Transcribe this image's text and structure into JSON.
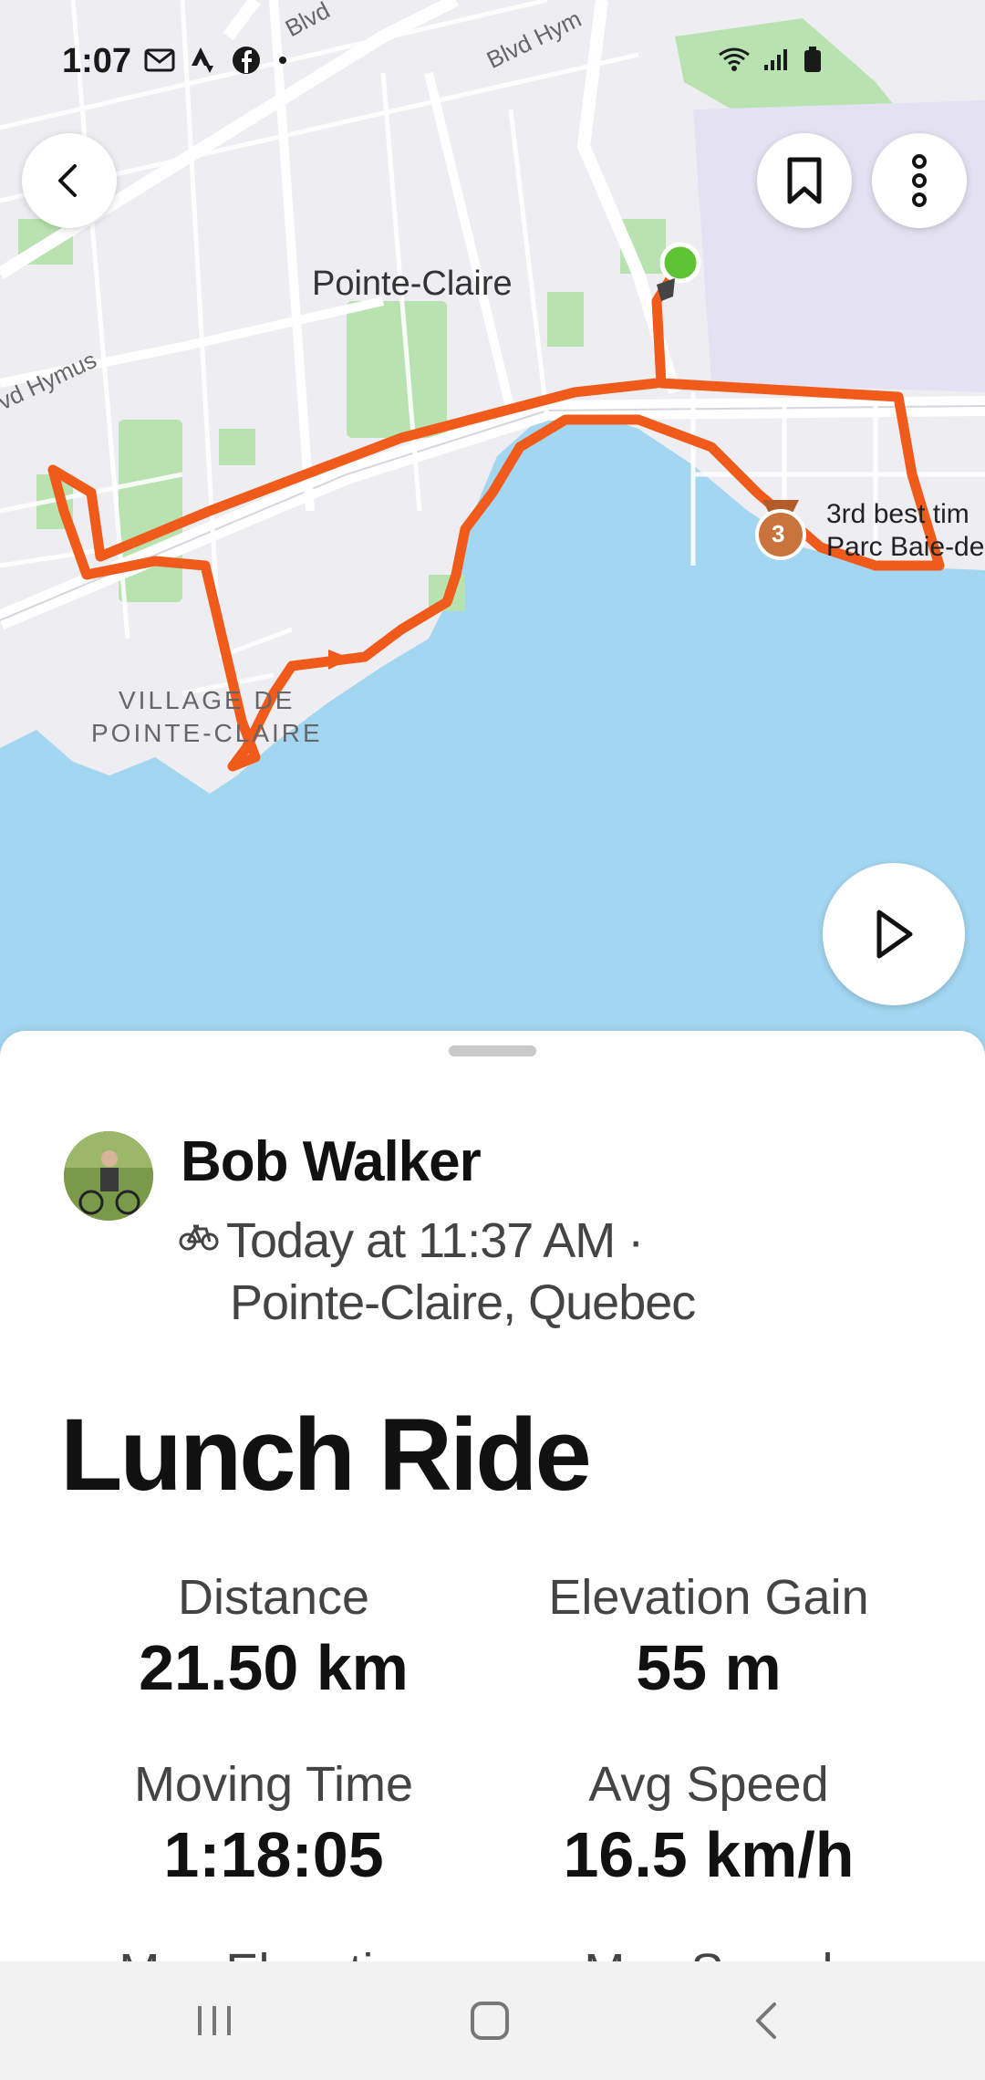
{
  "status_bar": {
    "time": "1:07",
    "icons_left": [
      "mail-icon",
      "strava-icon",
      "facebook-icon",
      "dot-icon"
    ],
    "icons_right": [
      "wifi-icon",
      "signal-icon",
      "battery-icon"
    ]
  },
  "map": {
    "labels": {
      "city": "Pointe-Claire",
      "village_line1": "VILLAGE DE",
      "village_line2": "POINTE-CLAIRE",
      "road_1": "Blvd",
      "road_2": "Blvd Hym",
      "road_3": "vd Hymus"
    },
    "segment": {
      "rank_badge": "3",
      "label_line1": "3rd best tim",
      "label_line2": "Parc Baie-de"
    },
    "colors": {
      "water": "#a3d6f1",
      "land": "#eeeef2",
      "park": "#b8e3b0",
      "route": "#f05a1a",
      "start": "#5ec435"
    }
  },
  "activity": {
    "athlete": "Bob Walker",
    "date_line": "Today at 11:37 AM ·",
    "location": "Pointe-Claire, Quebec",
    "sport_icon": "bike-icon",
    "title": "Lunch Ride"
  },
  "stats": [
    {
      "label": "Distance",
      "value": "21.50 km"
    },
    {
      "label": "Elevation Gain",
      "value": "55 m"
    },
    {
      "label": "Moving Time",
      "value": "1:18:05"
    },
    {
      "label": "Avg Speed",
      "value": "16.5 km/h"
    },
    {
      "label": "Max Elevation",
      "value": ""
    },
    {
      "label": "Max Speed",
      "value": ""
    }
  ],
  "partial_labels": {
    "left": "Max Elevation",
    "right": "Max Speed"
  }
}
